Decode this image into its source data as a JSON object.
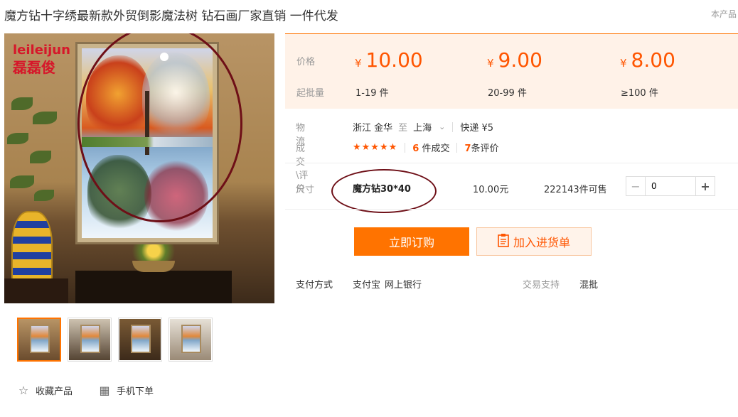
{
  "product": {
    "title": "魔方钻十字绣最新款外贸倒影魔法树 钻石画厂家直销 一件代发",
    "top_link": "本产品",
    "watermark_line1": "leileijun",
    "watermark_line2": "磊磊俊"
  },
  "pricing": {
    "price_label": "价格",
    "min_qty_label": "起批量",
    "currency": "¥",
    "tiers": [
      {
        "price": "10.00",
        "range": "1-19 件"
      },
      {
        "price": "9.00",
        "range": "20-99 件"
      },
      {
        "price": "8.00",
        "range": "≥100 件"
      }
    ],
    "accent_color": "#ff5500"
  },
  "logistics": {
    "label": "物流",
    "origin": "浙江 金华",
    "to": "至",
    "destination": "上海",
    "shipping": "快递 ¥5"
  },
  "reviews": {
    "label": "成交\\评价",
    "stars": "★★★★★",
    "deals_count": "6",
    "deals_text": "件成交",
    "review_count": "7",
    "review_text": "条评价"
  },
  "spec": {
    "label": "尺寸",
    "name": "魔方钻30*40",
    "price": "10.00元",
    "stock": "222143件可售",
    "quantity": "0",
    "minus": "−",
    "plus": "+"
  },
  "buttons": {
    "buy": "立即订购",
    "cart": "加入进货单"
  },
  "payment": {
    "label": "支付方式",
    "methods": [
      "支付宝",
      "网上银行"
    ],
    "trade_label": "交易支持",
    "trade_value": "混批"
  },
  "actions": {
    "favorite": "收藏产品",
    "mobile": "手机下单"
  },
  "icons": {
    "favorite": "☆",
    "mobile": "▦",
    "cart": "📋",
    "chevron": "⌄"
  }
}
